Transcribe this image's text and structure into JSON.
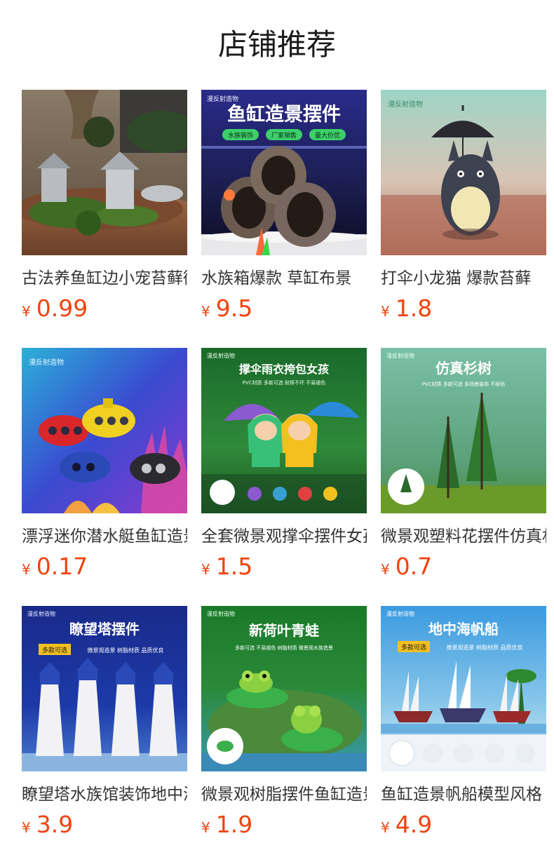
{
  "header": {
    "title": "店铺推荐"
  },
  "currency_symbol": "¥",
  "products": [
    {
      "name": "古法养鱼缸边小宠苔藓微景观",
      "price": "0.99",
      "image_icon": "pagoda-moss-image"
    },
    {
      "name": "水族箱爆款 草缸布景",
      "price": "9.5",
      "image_icon": "barrel-image",
      "image_text": {
        "headline": "鱼缸造景摆件",
        "badges": [
          "水族装饰",
          "厂家销售",
          "量大价优"
        ],
        "logo": "漫反射造物"
      }
    },
    {
      "name": "打伞小龙猫 爆款苔藓",
      "price": "1.8",
      "image_icon": "totoro-umbrella-image",
      "image_text": {
        "logo": "漫反射造物"
      }
    },
    {
      "name": "漂浮迷你潜水艇鱼缸造景",
      "price": "0.17",
      "image_icon": "submarine-image",
      "image_text": {
        "logo": "漫反射造物"
      }
    },
    {
      "name": "全套微景观撑伞摆件女孩",
      "price": "1.5",
      "image_icon": "raincoat-kids-image",
      "image_text": {
        "headline": "撑伞雨衣挎包女孩",
        "sub": "PVC材质  多款可选  耐摔不坏  不易褪色",
        "logo": "漫反射造物"
      }
    },
    {
      "name": "微景观塑料花摆件仿真杉树",
      "price": "0.7",
      "image_icon": "fir-tree-image",
      "image_text": {
        "headline": "仿真杉树",
        "sub": "PVC材质  多款可选  多场景装饰  不掉色",
        "logo": "漫反射造物"
      }
    },
    {
      "name": "瞭望塔水族馆装饰地中海",
      "price": "3.9",
      "image_icon": "lighthouse-image",
      "image_text": {
        "headline": "瞭望塔摆件",
        "tag": "多款可选",
        "sub": "微景观造景  树脂材质  品质优良",
        "logo": "漫反射造物"
      }
    },
    {
      "name": "微景观树脂摆件鱼缸造景",
      "price": "1.9",
      "image_icon": "lotus-frog-image",
      "image_text": {
        "headline": "新荷叶青蛙",
        "sub": "多款可选  不易褪色  树脂材质  微景观水族造景",
        "logo": "漫反射造物"
      }
    },
    {
      "name": "鱼缸造景帆船模型风格",
      "price": "4.9",
      "image_icon": "sailboat-image",
      "image_text": {
        "headline": "地中海帆船",
        "tag": "多款可选",
        "sub": "微景观造景  树脂材质  品质优良",
        "logo": "漫反射造物"
      }
    }
  ]
}
